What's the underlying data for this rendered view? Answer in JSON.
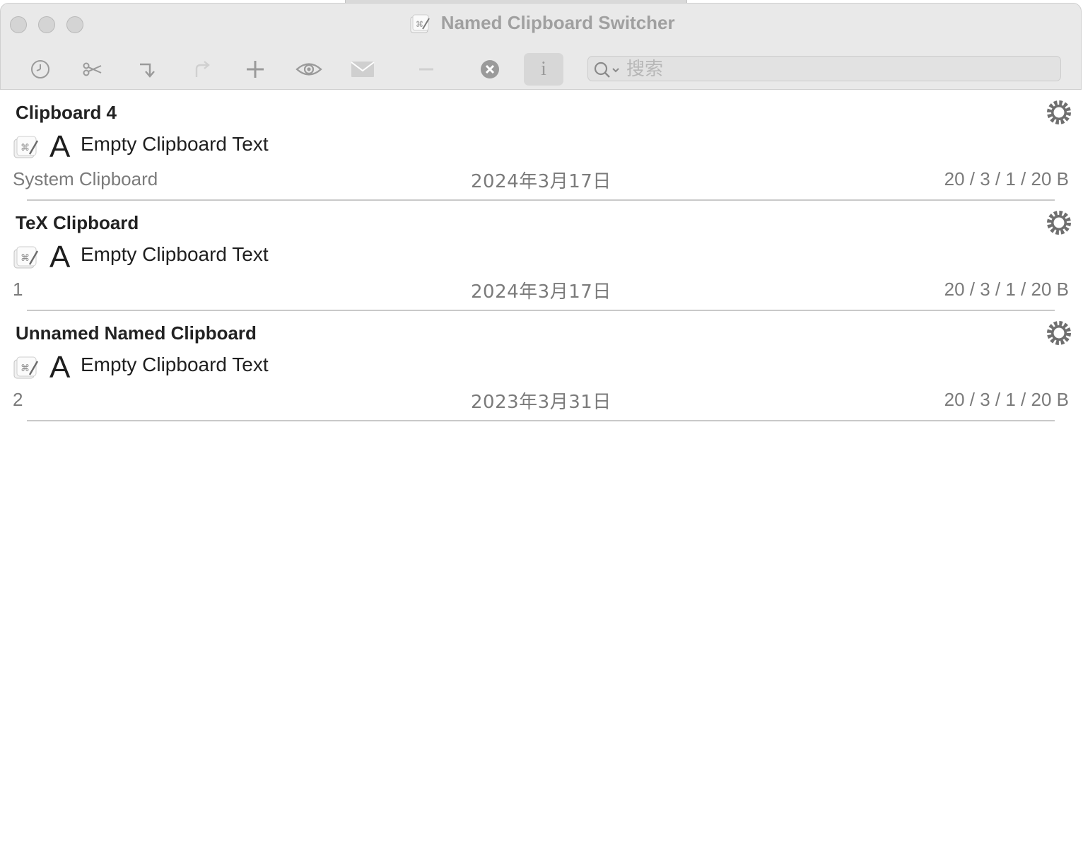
{
  "window": {
    "title": "Named Clipboard Switcher",
    "title_icon": "clipboard-app-icon"
  },
  "toolbar": {
    "buttons": [
      {
        "name": "history",
        "icon": "clock-icon",
        "enabled": true
      },
      {
        "name": "cut",
        "icon": "scissors-icon",
        "enabled": true
      },
      {
        "name": "switch",
        "icon": "arrow-turn-down-icon",
        "enabled": true
      },
      {
        "name": "redo",
        "icon": "arrow-redo-icon",
        "enabled": false
      },
      {
        "name": "add",
        "icon": "plus-icon",
        "enabled": true
      },
      {
        "name": "preview",
        "icon": "eye-icon",
        "enabled": true
      },
      {
        "name": "email",
        "icon": "envelope-icon",
        "enabled": false
      },
      {
        "name": "remove",
        "icon": "minus-icon",
        "enabled": false
      },
      {
        "name": "clear",
        "icon": "x-circle-icon",
        "enabled": true
      },
      {
        "name": "info",
        "icon": "info-icon",
        "enabled": true,
        "active": true
      }
    ],
    "info_label": "i"
  },
  "search": {
    "placeholder": "搜索",
    "value": ""
  },
  "clipboards": [
    {
      "name": "Clipboard 4",
      "type_label": "A",
      "content": "Empty Clipboard Text",
      "source": "System Clipboard",
      "date": "2024年3月17日",
      "stats": "20 / 3 / 1 / 20 B"
    },
    {
      "name": "TeX Clipboard",
      "type_label": "A",
      "content": "Empty Clipboard Text",
      "source": "1",
      "date": "2024年3月17日",
      "stats": "20 / 3 / 1 / 20 B"
    },
    {
      "name": "Unnamed Named Clipboard",
      "type_label": "A",
      "content": "Empty Clipboard Text",
      "source": "2",
      "date": "2023年3月31日",
      "stats": "20 / 3 / 1 / 20 B"
    }
  ],
  "colors": {
    "titlebar_bg": "#e9e9e9",
    "toolbar_icon": "#9a9a9a",
    "toolbar_icon_disabled": "#cfcfcf",
    "secondary_text": "#7b7b7b",
    "active_button_bg": "#d7d7d7"
  }
}
